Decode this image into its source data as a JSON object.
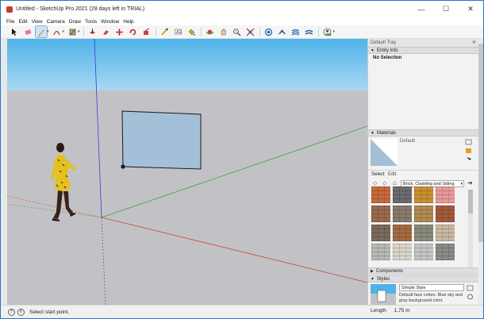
{
  "window": {
    "title": "Untitled - SketchUp Pro 2021 (28 days left in TRIAL)",
    "minimize": "—",
    "maximize": "☐",
    "close": "✕"
  },
  "menu": [
    "File",
    "Edit",
    "View",
    "Camera",
    "Draw",
    "Tools",
    "Window",
    "Help"
  ],
  "toolbar": {
    "tools": [
      "select-arrow-icon",
      "eraser-icon",
      "pencil-line-icon",
      "arc-icon",
      "rectangle-icon",
      "push-pull-icon",
      "follow-me-icon",
      "move-icon",
      "rotate-icon",
      "offset-icon",
      "tape-measure-icon",
      "text-icon",
      "paint-bucket-icon",
      "orbit-icon",
      "pan-icon",
      "zoom-icon",
      "zoom-extents-icon",
      "warehouse-icon",
      "extension-warehouse-icon",
      "layers-icon",
      "styles-icon",
      "account-icon"
    ],
    "active_tool": "pencil-line-icon"
  },
  "tray": {
    "title": "Default Tray",
    "close": "✕",
    "entity_info": {
      "header": "Entity Info",
      "selection": "No Selection"
    },
    "materials": {
      "header": "Materials",
      "current_name": "Default",
      "tabs": [
        "Select",
        "Edit"
      ],
      "library": "Brick, Cladding and Siding",
      "swatch_colors": [
        "#c8693a",
        "#6b6b70",
        "#c89030",
        "#e89a9a",
        "#9a6a4a",
        "#8a7a6a",
        "#b08a50",
        "#a05a3a",
        "#7a6a5a",
        "#a46a40",
        "#8a8a7a",
        "#c9b8a0",
        "#b8b8b4",
        "#d8d4cc",
        "#c4c4c4",
        "#8a8a86",
        "#5a5a56",
        "#9a9a92",
        "#7a6a62",
        "#b0a090"
      ]
    },
    "components": {
      "header": "Components"
    },
    "styles": {
      "header": "Styles",
      "style_name": "Simple Style",
      "description": "Default face colors. Blue sky and gray background color."
    }
  },
  "status": {
    "message": "Select start point.",
    "measurements_label": "Length",
    "measurements_value": "1,75 m"
  },
  "colors": {
    "sky_top": "#4fb3ea",
    "ground": "#c2c2c6",
    "red_axis": "#d04040",
    "green_axis": "#3aa040",
    "blue_axis": "#3a3adc",
    "face": "#a4c0d8"
  }
}
